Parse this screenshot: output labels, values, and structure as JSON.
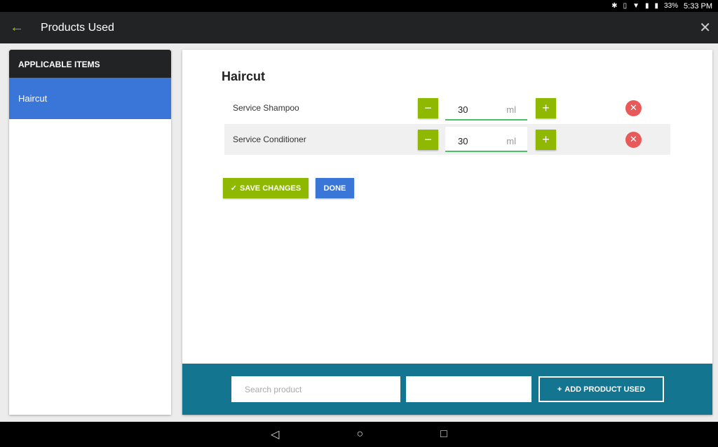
{
  "status": {
    "battery": "33%",
    "time": "5:33 PM"
  },
  "appbar": {
    "title": "Products Used"
  },
  "sidebar": {
    "header": "APPLICABLE ITEMS",
    "items": [
      {
        "label": "Haircut"
      }
    ]
  },
  "main": {
    "title": "Haircut",
    "products": [
      {
        "name": "Service Shampoo",
        "quantity": "30",
        "unit": "ml"
      },
      {
        "name": "Service Conditioner",
        "quantity": "30",
        "unit": "ml"
      }
    ],
    "save_label": "SAVE CHANGES",
    "done_label": "DONE"
  },
  "footer": {
    "search_placeholder": "Search product",
    "add_label": "ADD PRODUCT USED"
  },
  "colors": {
    "accent_green": "#8fb800",
    "primary_blue": "#3a76d8",
    "footer_teal": "#147590",
    "delete_red": "#e85a5a"
  }
}
